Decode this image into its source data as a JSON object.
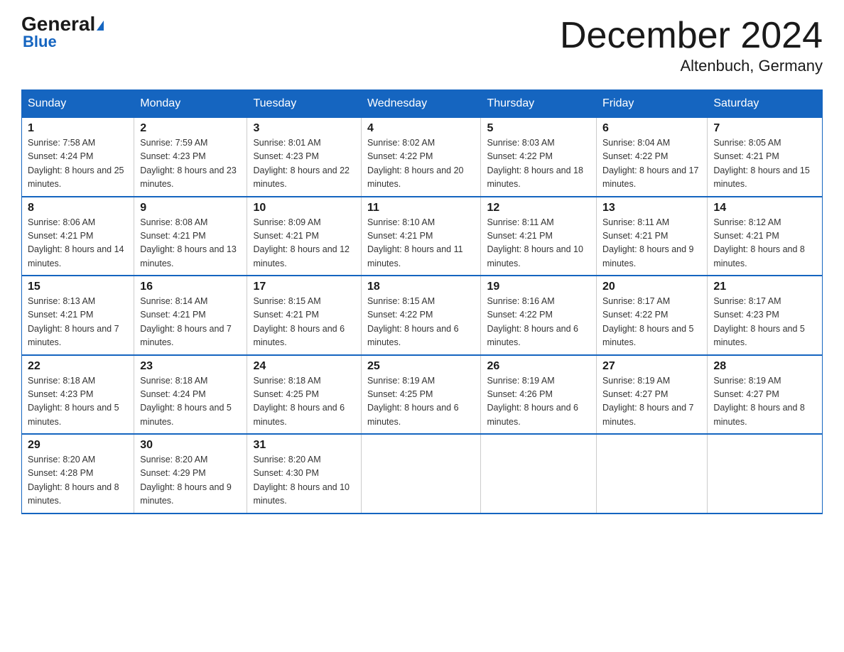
{
  "logo": {
    "general": "General",
    "triangle": "▲",
    "blue": "Blue"
  },
  "title": "December 2024",
  "location": "Altenbuch, Germany",
  "days_of_week": [
    "Sunday",
    "Monday",
    "Tuesday",
    "Wednesday",
    "Thursday",
    "Friday",
    "Saturday"
  ],
  "weeks": [
    [
      {
        "day": "1",
        "sunrise": "7:58 AM",
        "sunset": "4:24 PM",
        "daylight": "8 hours and 25 minutes."
      },
      {
        "day": "2",
        "sunrise": "7:59 AM",
        "sunset": "4:23 PM",
        "daylight": "8 hours and 23 minutes."
      },
      {
        "day": "3",
        "sunrise": "8:01 AM",
        "sunset": "4:23 PM",
        "daylight": "8 hours and 22 minutes."
      },
      {
        "day": "4",
        "sunrise": "8:02 AM",
        "sunset": "4:22 PM",
        "daylight": "8 hours and 20 minutes."
      },
      {
        "day": "5",
        "sunrise": "8:03 AM",
        "sunset": "4:22 PM",
        "daylight": "8 hours and 18 minutes."
      },
      {
        "day": "6",
        "sunrise": "8:04 AM",
        "sunset": "4:22 PM",
        "daylight": "8 hours and 17 minutes."
      },
      {
        "day": "7",
        "sunrise": "8:05 AM",
        "sunset": "4:21 PM",
        "daylight": "8 hours and 15 minutes."
      }
    ],
    [
      {
        "day": "8",
        "sunrise": "8:06 AM",
        "sunset": "4:21 PM",
        "daylight": "8 hours and 14 minutes."
      },
      {
        "day": "9",
        "sunrise": "8:08 AM",
        "sunset": "4:21 PM",
        "daylight": "8 hours and 13 minutes."
      },
      {
        "day": "10",
        "sunrise": "8:09 AM",
        "sunset": "4:21 PM",
        "daylight": "8 hours and 12 minutes."
      },
      {
        "day": "11",
        "sunrise": "8:10 AM",
        "sunset": "4:21 PM",
        "daylight": "8 hours and 11 minutes."
      },
      {
        "day": "12",
        "sunrise": "8:11 AM",
        "sunset": "4:21 PM",
        "daylight": "8 hours and 10 minutes."
      },
      {
        "day": "13",
        "sunrise": "8:11 AM",
        "sunset": "4:21 PM",
        "daylight": "8 hours and 9 minutes."
      },
      {
        "day": "14",
        "sunrise": "8:12 AM",
        "sunset": "4:21 PM",
        "daylight": "8 hours and 8 minutes."
      }
    ],
    [
      {
        "day": "15",
        "sunrise": "8:13 AM",
        "sunset": "4:21 PM",
        "daylight": "8 hours and 7 minutes."
      },
      {
        "day": "16",
        "sunrise": "8:14 AM",
        "sunset": "4:21 PM",
        "daylight": "8 hours and 7 minutes."
      },
      {
        "day": "17",
        "sunrise": "8:15 AM",
        "sunset": "4:21 PM",
        "daylight": "8 hours and 6 minutes."
      },
      {
        "day": "18",
        "sunrise": "8:15 AM",
        "sunset": "4:22 PM",
        "daylight": "8 hours and 6 minutes."
      },
      {
        "day": "19",
        "sunrise": "8:16 AM",
        "sunset": "4:22 PM",
        "daylight": "8 hours and 6 minutes."
      },
      {
        "day": "20",
        "sunrise": "8:17 AM",
        "sunset": "4:22 PM",
        "daylight": "8 hours and 5 minutes."
      },
      {
        "day": "21",
        "sunrise": "8:17 AM",
        "sunset": "4:23 PM",
        "daylight": "8 hours and 5 minutes."
      }
    ],
    [
      {
        "day": "22",
        "sunrise": "8:18 AM",
        "sunset": "4:23 PM",
        "daylight": "8 hours and 5 minutes."
      },
      {
        "day": "23",
        "sunrise": "8:18 AM",
        "sunset": "4:24 PM",
        "daylight": "8 hours and 5 minutes."
      },
      {
        "day": "24",
        "sunrise": "8:18 AM",
        "sunset": "4:25 PM",
        "daylight": "8 hours and 6 minutes."
      },
      {
        "day": "25",
        "sunrise": "8:19 AM",
        "sunset": "4:25 PM",
        "daylight": "8 hours and 6 minutes."
      },
      {
        "day": "26",
        "sunrise": "8:19 AM",
        "sunset": "4:26 PM",
        "daylight": "8 hours and 6 minutes."
      },
      {
        "day": "27",
        "sunrise": "8:19 AM",
        "sunset": "4:27 PM",
        "daylight": "8 hours and 7 minutes."
      },
      {
        "day": "28",
        "sunrise": "8:19 AM",
        "sunset": "4:27 PM",
        "daylight": "8 hours and 8 minutes."
      }
    ],
    [
      {
        "day": "29",
        "sunrise": "8:20 AM",
        "sunset": "4:28 PM",
        "daylight": "8 hours and 8 minutes."
      },
      {
        "day": "30",
        "sunrise": "8:20 AM",
        "sunset": "4:29 PM",
        "daylight": "8 hours and 9 minutes."
      },
      {
        "day": "31",
        "sunrise": "8:20 AM",
        "sunset": "4:30 PM",
        "daylight": "8 hours and 10 minutes."
      },
      null,
      null,
      null,
      null
    ]
  ],
  "colors": {
    "header_bg": "#1565C0",
    "header_text": "#ffffff",
    "border": "#1565C0"
  }
}
